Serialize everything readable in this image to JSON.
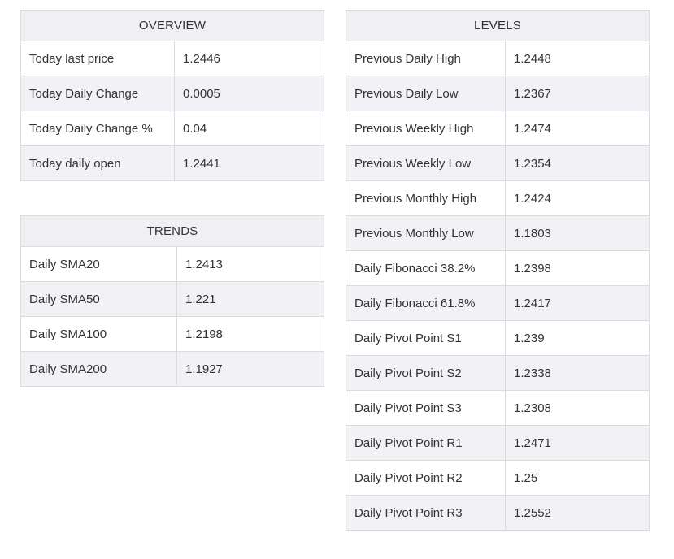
{
  "overview": {
    "title": "OVERVIEW",
    "rows": [
      {
        "label": "Today last price",
        "value": "1.2446"
      },
      {
        "label": "Today Daily Change",
        "value": "0.0005"
      },
      {
        "label": "Today Daily Change %",
        "value": "0.04"
      },
      {
        "label": "Today daily open",
        "value": "1.2441"
      }
    ]
  },
  "trends": {
    "title": "TRENDS",
    "rows": [
      {
        "label": "Daily SMA20",
        "value": "1.2413"
      },
      {
        "label": "Daily SMA50",
        "value": "1.221"
      },
      {
        "label": "Daily SMA100",
        "value": "1.2198"
      },
      {
        "label": "Daily SMA200",
        "value": "1.1927"
      }
    ]
  },
  "levels": {
    "title": "LEVELS",
    "rows": [
      {
        "label": "Previous Daily High",
        "value": "1.2448"
      },
      {
        "label": "Previous Daily Low",
        "value": "1.2367"
      },
      {
        "label": "Previous Weekly High",
        "value": "1.2474"
      },
      {
        "label": "Previous Weekly Low",
        "value": "1.2354"
      },
      {
        "label": "Previous Monthly High",
        "value": "1.2424"
      },
      {
        "label": "Previous Monthly Low",
        "value": "1.1803"
      },
      {
        "label": "Daily Fibonacci 38.2%",
        "value": "1.2398"
      },
      {
        "label": "Daily Fibonacci 61.8%",
        "value": "1.2417"
      },
      {
        "label": "Daily Pivot Point S1",
        "value": "1.239"
      },
      {
        "label": "Daily Pivot Point S2",
        "value": "1.2338"
      },
      {
        "label": "Daily Pivot Point S3",
        "value": "1.2308"
      },
      {
        "label": "Daily Pivot Point R1",
        "value": "1.2471"
      },
      {
        "label": "Daily Pivot Point R2",
        "value": "1.25"
      },
      {
        "label": "Daily Pivot Point R3",
        "value": "1.2552"
      }
    ]
  },
  "colors": {
    "header_bg": "#efeff4",
    "row_alt_bg": "#f2f2f6",
    "border": "#dcdcdc",
    "text": "#333333"
  }
}
